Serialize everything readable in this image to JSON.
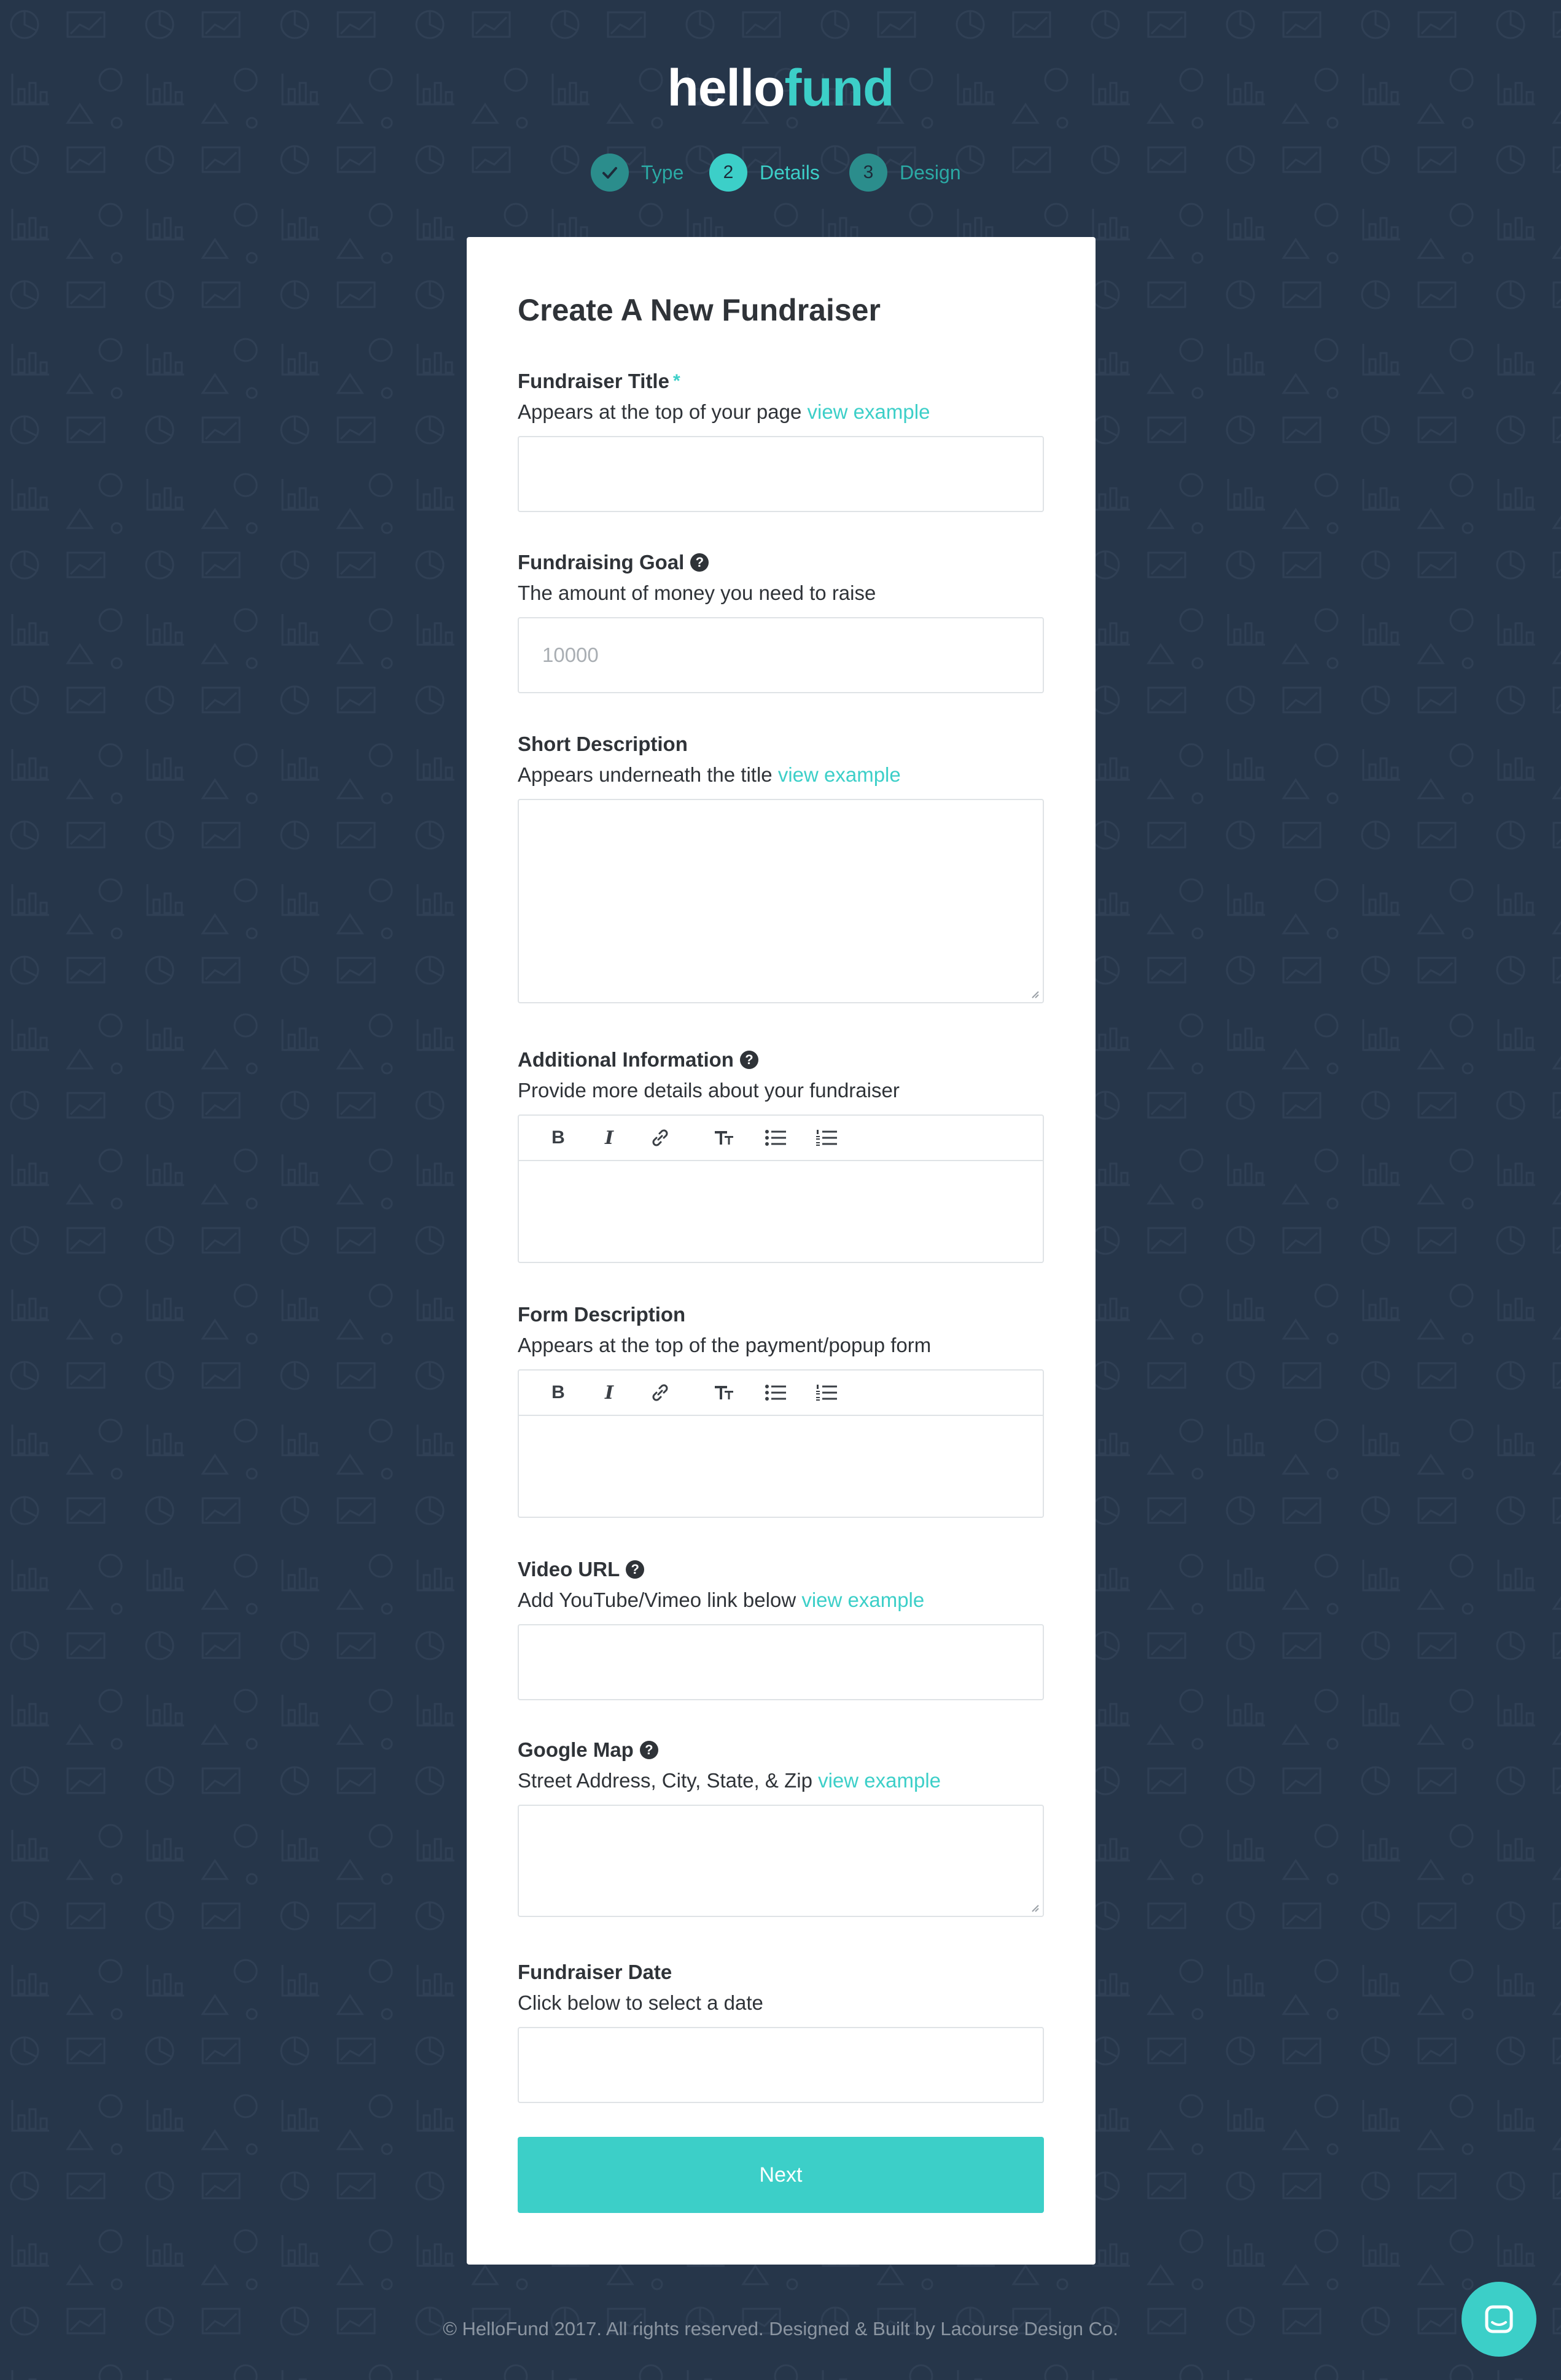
{
  "brand": {
    "part1": "hello",
    "part2": "fund"
  },
  "steps": [
    {
      "number": "",
      "label": "Type",
      "state": "done",
      "icon": "check-icon"
    },
    {
      "number": "2",
      "label": "Details",
      "state": "active"
    },
    {
      "number": "3",
      "label": "Design",
      "state": "todo"
    }
  ],
  "form": {
    "title": "Create A New Fundraiser",
    "fields": {
      "title": {
        "label": "Fundraiser Title",
        "required_mark": "*",
        "hint": "Appears at the top of your page",
        "link": "view example",
        "value": ""
      },
      "goal": {
        "label": "Fundraising Goal",
        "help": "?",
        "hint": "The amount of money you need to raise",
        "placeholder": "10000"
      },
      "short_description": {
        "label": "Short Description",
        "hint": "Appears underneath the title",
        "link": "view example"
      },
      "additional_info": {
        "label": "Additional Information",
        "help": "?",
        "hint": "Provide more details about your fundraiser"
      },
      "form_description": {
        "label": "Form Description",
        "hint": "Appears at the top of the payment/popup form"
      },
      "video_url": {
        "label": "Video URL",
        "help": "?",
        "hint": "Add YouTube/Vimeo link below",
        "link": "view example"
      },
      "google_map": {
        "label": "Google Map",
        "help": "?",
        "hint": "Street Address, City, State, & Zip",
        "link": "view example"
      },
      "date": {
        "label": "Fundraiser Date",
        "hint": "Click below to select a date"
      }
    },
    "toolbar": {
      "bold": "B",
      "italic": "I"
    },
    "next_label": "Next"
  },
  "footer": "© HelloFund 2017. All rights reserved. Designed & Built by Lacourse Design Co.",
  "colors": {
    "accent": "#3ccfc8",
    "background": "#26364a",
    "card": "#ffffff"
  }
}
